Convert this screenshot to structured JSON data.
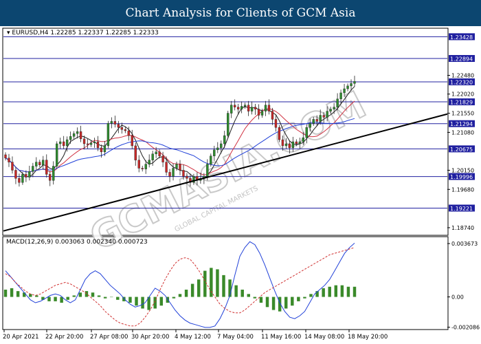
{
  "header": {
    "title": "Chart Analysis for Clients of GCM Asia"
  },
  "watermark": {
    "text": "GCMASIA.COM",
    "sub": "GLOBAL CAPITAL MARKETS"
  },
  "colors": {
    "banner": "#0c4670",
    "bull": "#2e8b2e",
    "bear": "#c62828",
    "ma_fast": "#1c1c1c",
    "ma_mid": "#d03040",
    "ma_slow": "#2040d8",
    "levels": "#2020a0",
    "trendline": "#000000",
    "macd_line": "#2040d8",
    "signal_line": "#d03030",
    "histogram": "#3a8a2a"
  },
  "chart_data": [
    {
      "type": "candlestick",
      "symbol_label": "EURUSD,H4",
      "ohlc_header": "1.22285 1.22337 1.22285 1.22333",
      "price_range": [
        1.1857,
        1.2362
      ],
      "x_ticks": [
        "20 Apr 2021",
        "22 Apr 20:00",
        "27 Apr 08:00",
        "30 Apr 20:00",
        "4 May 12:00",
        "7 May 04:00",
        "11 May 16:00",
        "14 May 08:00",
        "18 May 20:00"
      ],
      "y_ticks": [
        "1.22480",
        "1.22020",
        "1.21550",
        "1.21080",
        "1.20150",
        "1.19680",
        "1.18740"
      ],
      "levels": [
        {
          "value": 1.23428,
          "label": "1.23428"
        },
        {
          "value": 1.22894,
          "label": "1.22894"
        },
        {
          "value": 1.2232,
          "label": "1.22320"
        },
        {
          "value": 1.21829,
          "label": "1.21829"
        },
        {
          "value": 1.21294,
          "label": "1.21294"
        },
        {
          "value": 1.20675,
          "label": "1.20675"
        },
        {
          "value": 1.19996,
          "label": "1.19996"
        },
        {
          "value": 1.19221,
          "label": "1.19221"
        }
      ],
      "trendline": {
        "x": [
          0.0,
          1.0
        ],
        "y": [
          1.1866,
          1.2153
        ]
      },
      "closes": [
        1.2045,
        1.2035,
        1.2015,
        1.1995,
        1.1985,
        1.2005,
        1.1998,
        1.2012,
        1.2025,
        1.2035,
        1.2028,
        1.204,
        1.2005,
        1.199,
        1.2025,
        1.208,
        1.2085,
        1.2075,
        1.209,
        1.2098,
        1.2105,
        1.211,
        1.2092,
        1.208,
        1.2078,
        1.2082,
        1.2085,
        1.207,
        1.206,
        1.2075,
        1.213,
        1.2135,
        1.2128,
        1.212,
        1.2115,
        1.2112,
        1.21,
        1.2075,
        1.204,
        1.202,
        1.2018,
        1.203,
        1.204,
        1.2055,
        1.206,
        1.205,
        1.2035,
        1.201,
        1.2,
        1.202,
        1.203,
        1.2015,
        1.2,
        1.1995,
        1.1985,
        1.2,
        1.199,
        1.1995,
        1.2,
        1.203,
        1.205,
        1.2065,
        1.207,
        1.208,
        1.21,
        1.2155,
        1.2175,
        1.217,
        1.2165,
        1.2172,
        1.2175,
        1.216,
        1.217,
        1.2165,
        1.215,
        1.216,
        1.2175,
        1.216,
        1.214,
        1.212,
        1.209,
        1.2075,
        1.208,
        1.207,
        1.2085,
        1.208,
        1.2085,
        1.2095,
        1.212,
        1.213,
        1.214,
        1.2135,
        1.215,
        1.2145,
        1.216,
        1.2165,
        1.217,
        1.219,
        1.2205,
        1.2215,
        1.2222,
        1.2228,
        1.2233
      ]
    },
    {
      "type": "macd",
      "label": "MACD(12,26,9) 0.003063 0.002340 0.000723",
      "y_ticks": [
        "0.003673",
        "0.00",
        "-0.002086"
      ],
      "y_range": [
        -0.0022,
        0.0041
      ],
      "main": [
        0.0018,
        0.0014,
        0.001,
        0.0006,
        0.0002,
        -0.0002,
        -0.0004,
        -0.0003,
        -0.0001,
        0.0001,
        0.0002,
        0.0001,
        -0.0002,
        -0.0004,
        -0.0002,
        0.0005,
        0.0012,
        0.0016,
        0.0018,
        0.0016,
        0.0012,
        0.0008,
        0.0005,
        0.0002,
        -0.0002,
        -0.0005,
        -0.0007,
        -0.0006,
        -0.0004,
        0.0001,
        0.0006,
        0.0004,
        0.0001,
        -0.0004,
        -0.0009,
        -0.0013,
        -0.0016,
        -0.0018,
        -0.0019,
        -0.002,
        -0.0021,
        -0.0021,
        -0.002,
        -0.0015,
        -0.0008,
        0.0001,
        0.0015,
        0.0028,
        0.0034,
        0.0038,
        0.0036,
        0.003,
        0.0022,
        0.0013,
        0.0004,
        -0.0004,
        -0.001,
        -0.0014,
        -0.0015,
        -0.0013,
        -0.001,
        -0.0004,
        0.0002,
        0.0005,
        0.0008,
        0.0012,
        0.0018,
        0.0024,
        0.003,
        0.0034,
        0.0037
      ],
      "signal": [
        0.0016,
        0.0014,
        0.001,
        0.0007,
        0.0004,
        0.0002,
        0.0001,
        0.0002,
        0.0004,
        0.0006,
        0.0008,
        0.0009,
        0.001,
        0.0009,
        0.0007,
        0.0005,
        0.0003,
        0.0,
        -0.0003,
        -0.0006,
        -0.001,
        -0.0013,
        -0.0016,
        -0.0018,
        -0.0019,
        -0.002,
        -0.002,
        -0.0018,
        -0.0014,
        -0.0009,
        -0.0003,
        0.0005,
        0.0012,
        0.0018,
        0.0023,
        0.0026,
        0.0027,
        0.0026,
        0.0022,
        0.0017,
        0.0011,
        0.0005,
        0.0,
        -0.0005,
        -0.0008,
        -0.001,
        -0.0011,
        -0.0011,
        -0.0009,
        -0.0006,
        -0.0003,
        0.0,
        0.0003,
        0.0005,
        0.0007,
        0.0009,
        0.0011,
        0.0013,
        0.0015,
        0.0017,
        0.0019,
        0.0021,
        0.0023,
        0.0025,
        0.0027,
        0.0029,
        0.003,
        0.0031,
        0.0032,
        0.0033,
        0.0034
      ],
      "histogram": [
        0.0005,
        0.0006,
        0.0004,
        0.0003,
        0.0002,
        0.0001,
        -0.0002,
        -0.0003,
        -0.0003,
        -0.0004,
        -0.0002,
        0.0001,
        0.0003,
        0.0004,
        0.0003,
        0.0001,
        -0.0001,
        0.0,
        -0.0002,
        -0.0003,
        -0.0004,
        -0.0006,
        -0.0008,
        -0.0009,
        -0.0008,
        -0.0006,
        -0.0004,
        -0.0001,
        0.0002,
        0.0005,
        0.0009,
        0.0012,
        0.0018,
        0.002,
        0.0019,
        0.0015,
        0.0012,
        0.0008,
        0.0005,
        0.0002,
        -0.0001,
        -0.0004,
        -0.0007,
        -0.0009,
        -0.001,
        -0.0008,
        -0.0006,
        -0.0003,
        -0.0001,
        0.0002,
        0.0004,
        0.0006,
        0.0007,
        0.0008,
        0.0008,
        0.0007,
        0.0007
      ]
    }
  ]
}
